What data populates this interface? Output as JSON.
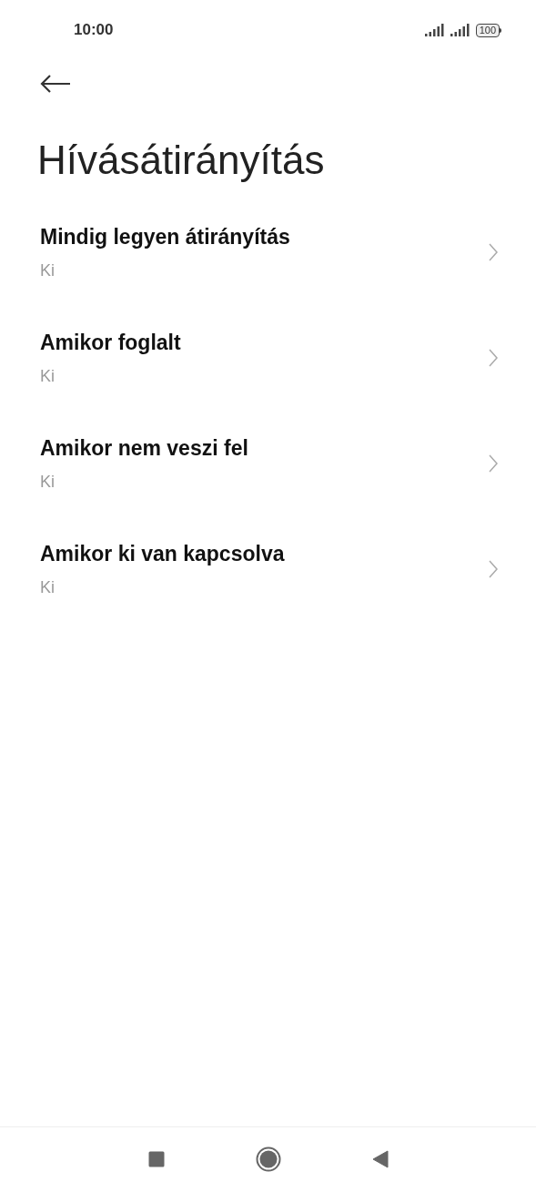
{
  "status_bar": {
    "time": "10:00",
    "battery": "100"
  },
  "title": "Hívásátirányítás",
  "items": [
    {
      "title": "Mindig legyen átirányítás",
      "value": "Ki"
    },
    {
      "title": "Amikor foglalt",
      "value": "Ki"
    },
    {
      "title": "Amikor nem veszi fel",
      "value": "Ki"
    },
    {
      "title": "Amikor ki van kapcsolva",
      "value": "Ki"
    }
  ]
}
